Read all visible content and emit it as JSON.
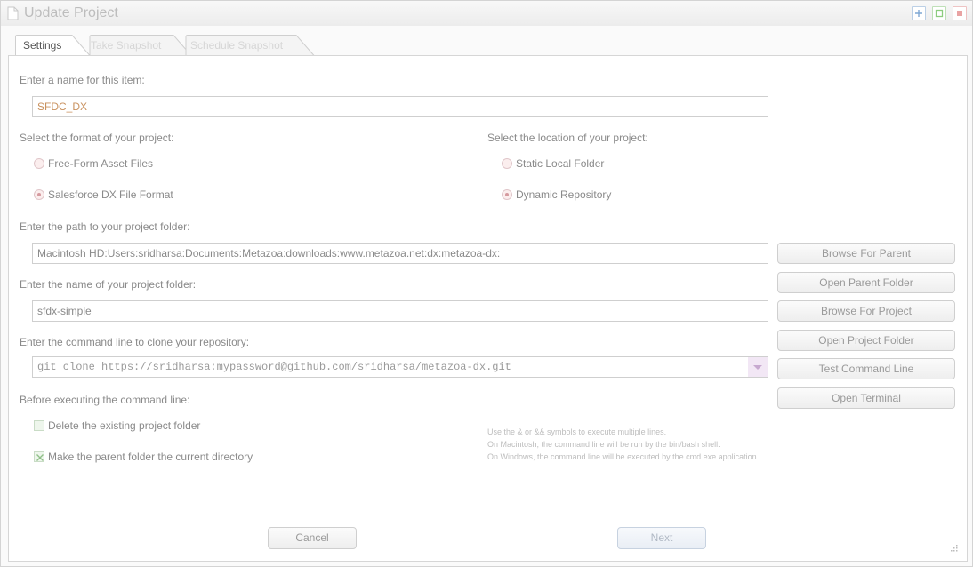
{
  "window": {
    "title": "Update Project"
  },
  "tabs": [
    {
      "label": "Settings",
      "active": true
    },
    {
      "label": "Take Snapshot",
      "active": false
    },
    {
      "label": "Schedule Snapshot",
      "active": false
    }
  ],
  "settings": {
    "name_label": "Enter a name for this item:",
    "name_value": "SFDC_DX",
    "format_label": "Select the format of your project:",
    "format_options": [
      {
        "label": "Free-Form Asset Files",
        "checked": false
      },
      {
        "label": "Salesforce DX File Format",
        "checked": true
      }
    ],
    "location_label": "Select the location of your project:",
    "location_options": [
      {
        "label": "Static Local Folder",
        "checked": false
      },
      {
        "label": "Dynamic Repository",
        "checked": true
      }
    ],
    "path_label": "Enter the path to your project folder:",
    "path_value": "Macintosh HD:Users:sridharsa:Documents:Metazoa:downloads:www.metazoa.net:dx:metazoa-dx:",
    "folder_label": "Enter the name of your project folder:",
    "folder_value": "sfdx-simple",
    "command_label": "Enter the command line to clone your repository:",
    "command_value": "git clone https://sridharsa:mypassword@github.com/sridharsa/metazoa-dx.git",
    "before_label": "Before executing the command line:",
    "checkboxes": [
      {
        "label": "Delete the existing project folder",
        "checked": false
      },
      {
        "label": "Make the parent folder the current directory",
        "checked": true
      }
    ],
    "hints": [
      "Use the & or && symbols to execute multiple lines.",
      "On Macintosh, the command line will be run by the bin/bash shell.",
      "On Windows, the command line will be executed by the cmd.exe application."
    ]
  },
  "side_buttons": {
    "browse_parent": "Browse For Parent",
    "open_parent": "Open Parent Folder",
    "browse_project": "Browse For Project",
    "open_project": "Open Project Folder",
    "test_command": "Test Command Line",
    "open_terminal": "Open Terminal"
  },
  "footer": {
    "cancel": "Cancel",
    "next": "Next"
  },
  "colors": {
    "accent_name_text": "#c9915e",
    "radio_fill": "#fbeeee",
    "checkbox_fill": "#eef6ec"
  }
}
